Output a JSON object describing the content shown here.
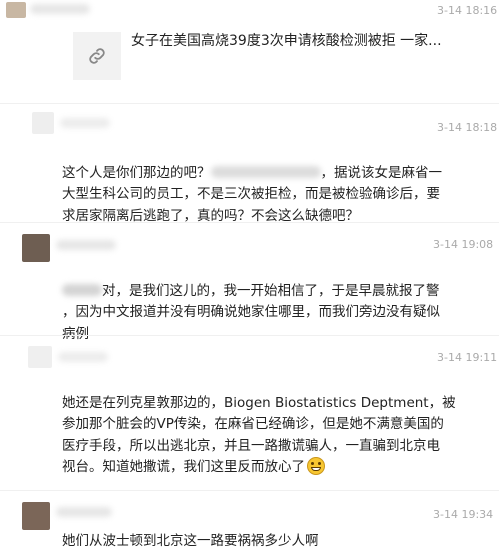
{
  "top_comment": {
    "time": "3-14 18:16",
    "link_title": "女子在美国高烧39度3次申请核酸检测被拒 一家..."
  },
  "comments": [
    {
      "time": "3-14 18:18",
      "line1": "这个人是你们那边的吧？",
      "line1b": "，据说该女是麻省一",
      "rest": "大型生科公司的员工，不是三次被拒检，而是被检验确诊后，要\n求居家隔离后逃跑了，真的吗？不会这么缺德吧？"
    },
    {
      "time": "3-14 19:08",
      "line1": "对，是我们这儿的，我一开始相信了，于是早晨就报了警",
      "rest": "，因为中文报道并没有明确说她家住哪里，而我们旁边没有疑似\n病例"
    },
    {
      "time": "3-14 19:11",
      "text": "她还是在列克星敦那边的，Biogen Biostatistics Deptment，被\n参加那个脏会的VP传染，在麻省已经确诊，但是她不满意美国的\n医疗手段，所以出逃北京，并且一路撒谎骗人，一直骗到北京电\n视台。知道她撒谎，我们这里反而放心了"
    },
    {
      "time": "3-14 19:34",
      "text": "她们从波士顿到北京这一路要祸祸多少人啊"
    }
  ],
  "icons": {
    "link": "link-icon",
    "emoji": "grin-emoji-icon"
  }
}
